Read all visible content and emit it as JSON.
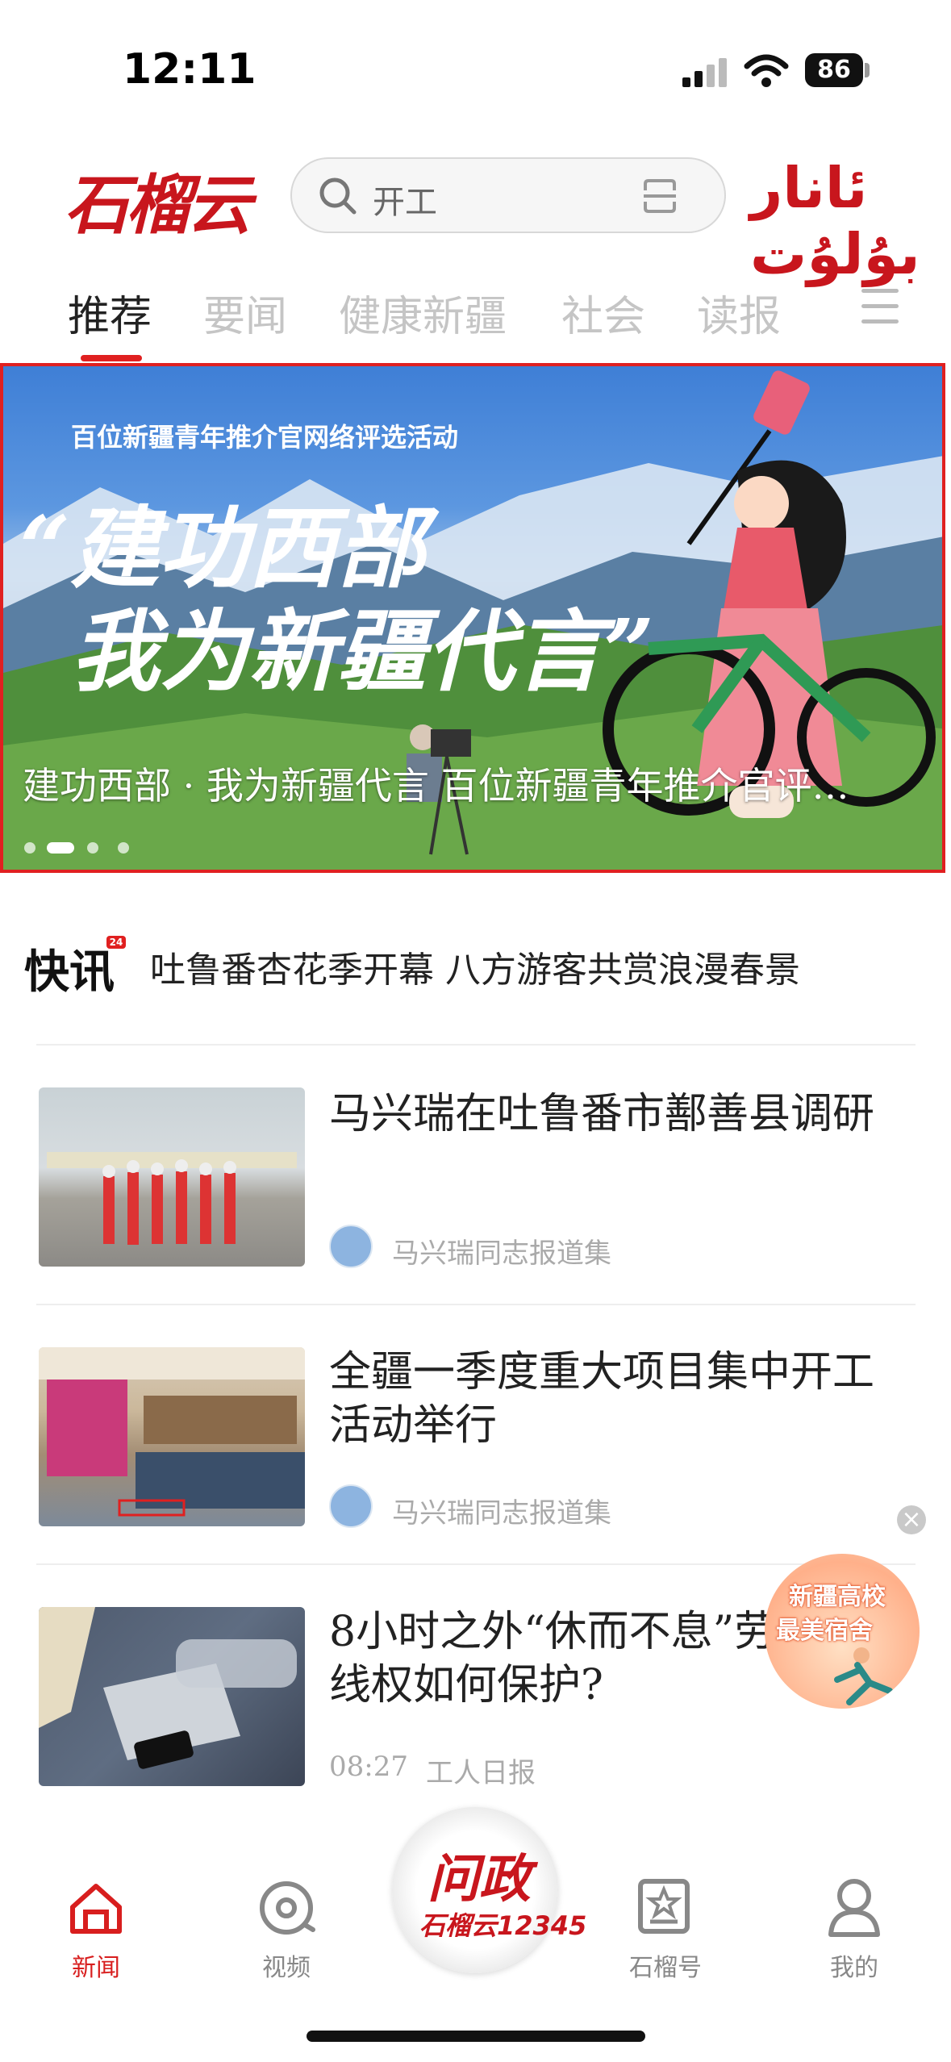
{
  "status_bar": {
    "time": "12:11",
    "battery": "86"
  },
  "header": {
    "logo_text": "石榴云",
    "search_placeholder": "开工",
    "ug_logo": "ئانار بۇلۇت"
  },
  "tabs": [
    "推荐",
    "要闻",
    "健康新疆",
    "社会",
    "读报"
  ],
  "active_tab": "推荐",
  "banner": {
    "subtitle": "百位新疆青年推介官网络评选活动",
    "headline_line1": "“建功西部",
    "headline_line2": "我为新疆代言”",
    "caption": "建功西部 · 我为新疆代言 百位新疆青年推介官评…",
    "slide_count": 4,
    "active_slide": 2
  },
  "flash": {
    "label": "快讯",
    "badge": "24",
    "text": "吐鲁番杏花季开幕 八方游客共赏浪漫春景"
  },
  "news": [
    {
      "title": "马兴瑞在吐鲁番市鄯善县调研",
      "source": "马兴瑞同志报道集",
      "time": "",
      "has_avatar": true
    },
    {
      "title": "全疆一季度重大项目集中开工活动举行",
      "source": "马兴瑞同志报道集",
      "time": "",
      "has_avatar": true
    },
    {
      "title": "8小时之外“休而不息”劳动者离线权如何保护?",
      "source": "工人日报",
      "time": "08:27",
      "has_avatar": false
    }
  ],
  "floating_ad": {
    "line1": "新疆高校",
    "line2": "最美宿舍"
  },
  "bottom_nav": {
    "items": [
      {
        "label": "新闻",
        "icon": "home-icon",
        "active": true
      },
      {
        "label": "视频",
        "icon": "video-icon",
        "active": false
      },
      {
        "label": "石榴号",
        "icon": "account-icon",
        "active": false
      },
      {
        "label": "我的",
        "icon": "user-icon",
        "active": false
      }
    ],
    "center_line1": "问政",
    "center_line2": "石榴云12345"
  },
  "colors": {
    "brand_red": "#c8161d",
    "active_red": "#e02020"
  }
}
